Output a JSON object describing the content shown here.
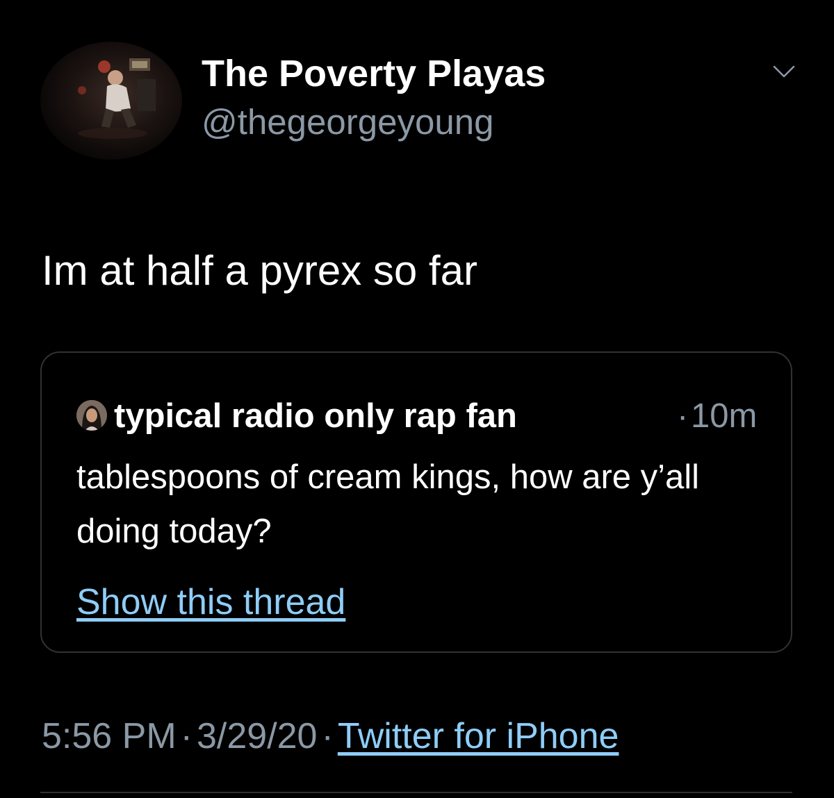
{
  "tweet": {
    "author": {
      "display_name": "The Poverty Playas",
      "handle": "@thegeorgeyoung",
      "avatar_icon": "user-photo-avatar"
    },
    "menu_icon": "chevron-down-icon",
    "text": "Im at half a pyrex so far",
    "quoted_tweet": {
      "author_name": "typical radio only rap fan",
      "separator": "·",
      "time_ago": "10m",
      "text": "tablespoons of cream kings, how are y’all doing today?",
      "show_thread_label": "Show this thread",
      "avatar_icon": "user-photo-avatar"
    },
    "meta": {
      "time": "5:56 PM",
      "separator": "·",
      "date": "3/29/20",
      "source": "Twitter for iPhone"
    }
  },
  "colors": {
    "background": "#000000",
    "primary_text": "#ffffff",
    "secondary_text": "#8b98a5",
    "link": "#8ecdf8",
    "border": "#2f3336"
  }
}
